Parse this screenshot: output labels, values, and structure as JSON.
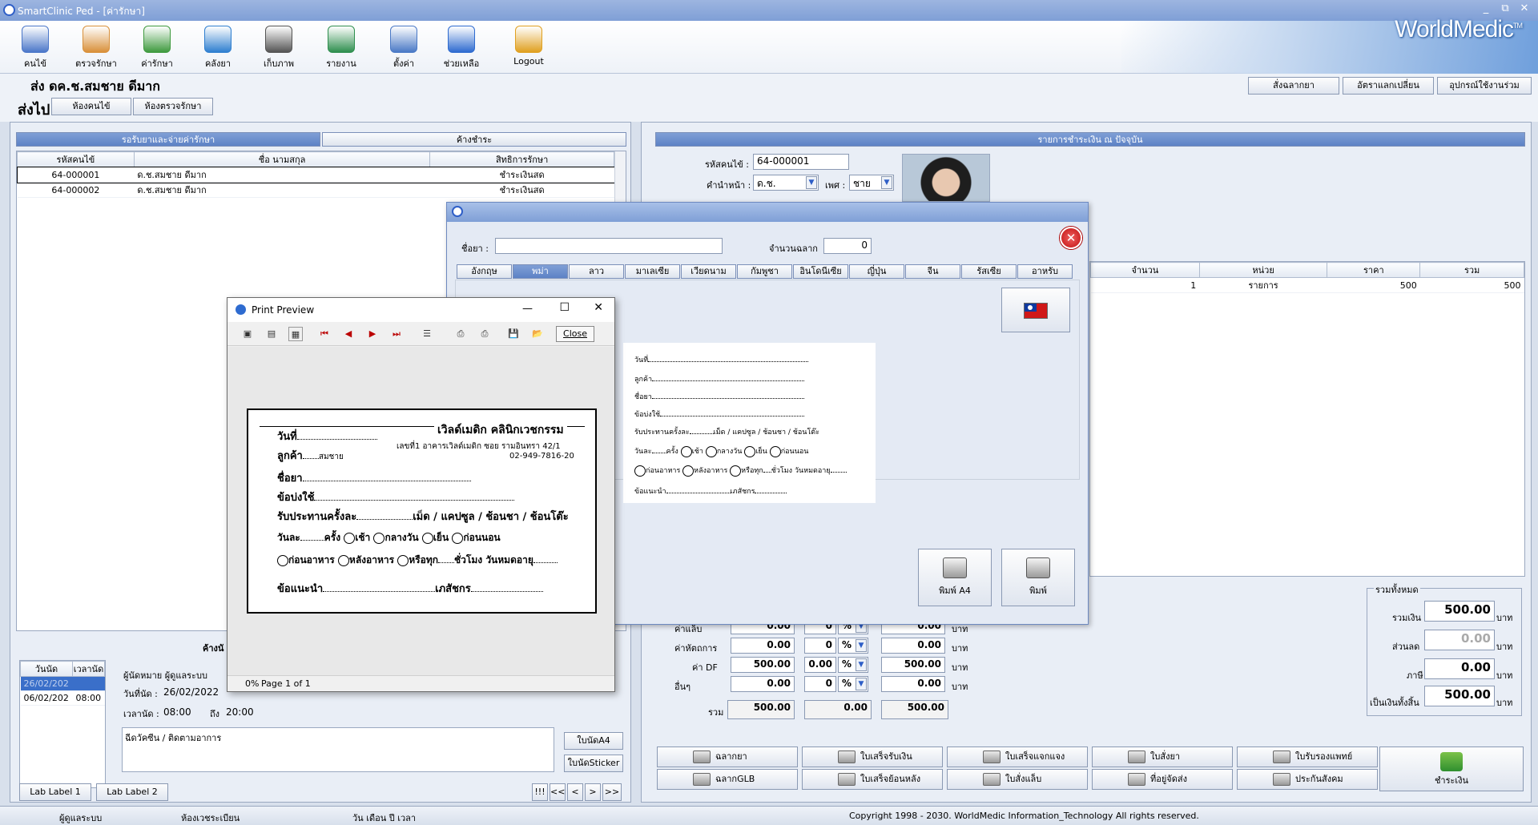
{
  "window": {
    "title": "SmartClinic Ped - [ค่ารักษา]",
    "minimize": "_",
    "restore": "⧉",
    "close": "✕"
  },
  "toolbar": {
    "items": [
      {
        "label": "คนไข้",
        "icon": "patient-icon",
        "color": "#4b77c9"
      },
      {
        "label": "ตรวจรักษา",
        "icon": "doctor-icon",
        "color": "#d9903a"
      },
      {
        "label": "ค่ารักษา",
        "icon": "money-icon",
        "color": "#3f9a3f"
      },
      {
        "label": "คลังยา",
        "icon": "pill-icon",
        "color": "#2f7fd0"
      },
      {
        "label": "เก็บภาพ",
        "icon": "camera-icon",
        "color": "#555555"
      },
      {
        "label": "รายงาน",
        "icon": "report-icon",
        "color": "#2f8f4f"
      },
      {
        "label": "ตั้งค่า",
        "icon": "settings-icon",
        "color": "#4a79c6"
      },
      {
        "label": "ช่วยเหลือ",
        "icon": "help-icon",
        "color": "#2e6bd0"
      },
      {
        "label": "Logout",
        "icon": "lock-icon",
        "color": "#e0a020"
      }
    ],
    "logo": "WorldMedic",
    "logo_tm": "TM"
  },
  "header": {
    "patient_line": "ส่ง   ดค.ช.สมชาย ดีมาก",
    "send_label": "ส่งไป",
    "send_buttons": [
      "ห้องคนไข้",
      "ห้องตรวจรักษา"
    ],
    "right_buttons": [
      "สั่งฉลากยา",
      "อัตราแลกเปลี่ยน",
      "อุปกรณ์ใช้งานร่วม"
    ]
  },
  "left_panel": {
    "tabs": [
      "รอรับยาและจ่ายค่ารักษา",
      "ค้างชำระ"
    ],
    "columns": [
      "รหัสคนไข้",
      "ชื่อ นามสกุล",
      "สิทธิการรักษา"
    ],
    "rows": [
      [
        "64-000001",
        "ด.ช.สมชาย ดีมาก",
        "ชำระเงินสด"
      ],
      [
        "64-000002",
        "ด.ช.สมชาย ดีมาก",
        "ชำระเงินสด"
      ]
    ],
    "appointment_header": "ค้างนั",
    "appt_columns": [
      "วันนัด",
      "เวลานัด"
    ],
    "appt_rows": [
      [
        "06/02/202",
        "08:00"
      ]
    ],
    "appt_selected": "26/02/202",
    "appt_by_label": "ผู้นัดหมาย ผู้ดูแลระบบ",
    "appt_date_label": "วันที่นัด :",
    "appt_date": "26/02/2022",
    "appt_time_label": "เวลานัด :",
    "appt_time_from": "08:00",
    "appt_to_label": "ถึง",
    "appt_time_to": "20:00",
    "appt_note": "ฉีดวัคซีน / ติดตามอาการ",
    "btn_a4": "ใบนัดA4",
    "btn_sticker": "ใบนัดSticker",
    "lab_labels": [
      "Lab Label 1",
      "Lab Label 2"
    ],
    "nav": [
      "!!!",
      "<<",
      "<",
      ">",
      ">>"
    ]
  },
  "right_panel": {
    "title": "รายการชำระเงิน ณ ปัจจุบัน",
    "hn_label": "รหัสคนไข้ :",
    "hn": "64-000001",
    "prefix_label": "คำนำหน้า :",
    "prefix": "ด.ช.",
    "sex_label": "เพศ :",
    "sex": "ชาย",
    "columns": [
      "จำนวน",
      "หน่วย",
      "ราคา",
      "รวม"
    ],
    "rows": [
      [
        "1",
        "รายการ",
        "500",
        "500"
      ]
    ],
    "calc_rows": [
      {
        "label": "ค่าแล็บ",
        "a": "0.00",
        "pct": "0",
        "b": "0.00"
      },
      {
        "label": "ค่าหัตถการ",
        "a": "0.00",
        "pct": "0",
        "b": "0.00"
      },
      {
        "label": "ค่า DF",
        "a": "500.00",
        "pct": "0.00",
        "b": "500.00"
      },
      {
        "label": "อื่นๆ",
        "a": "0.00",
        "pct": "0",
        "b": "0.00"
      }
    ],
    "pct_symbol": "%",
    "unit": "บาท",
    "total_label": "รวม",
    "total_a": "500.00",
    "total_b": "0.00",
    "total_c": "500.00",
    "summary_title": "รวมทั้งหมด",
    "sum_label": "รวมเงิน",
    "sum": "500.00",
    "discount_label": "ส่วนลด",
    "discount": "0.00",
    "tax_label": "ภาษี",
    "tax": "0.00",
    "grand_label": "เป็นเงินทั้งสิ้น",
    "grand": "500.00"
  },
  "actions": {
    "row1": [
      "ฉลากยา",
      "ใบเสร็จรับเงิน",
      "ใบเสร็จแจกแจง",
      "ใบสั่งยา",
      "ใบรับรองแพทย์"
    ],
    "row2": [
      "ฉลากGLB",
      "ใบเสร็จย้อนหลัง",
      "ใบสั่งแล็บ",
      "ที่อยู่จัดส่ง",
      "ประกันสังคม"
    ],
    "pay": "ชำระเงิน"
  },
  "dialog": {
    "drug_label": "ชื่อยา :",
    "drug_value": "",
    "qty_label": "จำนวนฉลาก",
    "qty_value": "0",
    "lang_tabs": [
      "อังกฤษ",
      "พม่า",
      "ลาว",
      "มาเลเซีย",
      "เวียดนาม",
      "กัมพูชา",
      "อินโดนีเซีย",
      "ญี่ปุ่น",
      "จีน",
      "รัสเซีย",
      "อาหรับ"
    ],
    "active_tab": 1,
    "print_a4": "พิมพ์ A4",
    "print": "พิมพ์"
  },
  "print_preview": {
    "title": "Print Preview",
    "close_btn": "Close",
    "status_zoom": "0%",
    "status_page": "Page 1 of 1",
    "card": {
      "clinic": "เวิลด์เมดิก คลินิกเวชกรรม",
      "address": "เลขที่1 อาคารเวิลด์เมดิก ซอย รามอินทรา 42/1",
      "phone": "02-949-7816-20",
      "date": "วันที่",
      "name": "ลูกค้า",
      "name_value": "สมชาย",
      "drug": "ชื่อยา",
      "usage": "ข้อบ่งใช้",
      "take": "รับประทานครั้งละ",
      "unit": "เม็ด / แคปซูล / ช้อนชา / ช้อนโต๊ะ",
      "perday": "วันละ",
      "times": "ครั้ง",
      "morning": "เช้า",
      "noon": "กลางวัน",
      "evening": "เย็น",
      "bedtime": "ก่อนนอน",
      "before_meal": "ก่อนอาหาร",
      "after_meal": "หลังอาหาร",
      "or_every": "หรือทุก",
      "hours": "ชั่วโมง",
      "expire": "วันหมดอายุ",
      "advice": "ข้อแนะนำ",
      "pharmacist": "เภสัชกร"
    }
  },
  "statusbar": {
    "user": "ผู้ดูแลระบบ",
    "room": "ห้องเวชระเบียน",
    "date": "วัน เดือน ปี เวลา",
    "copyright": "Copyright 1998 - 2030. WorldMedic Information_Technology All rights reserved."
  }
}
